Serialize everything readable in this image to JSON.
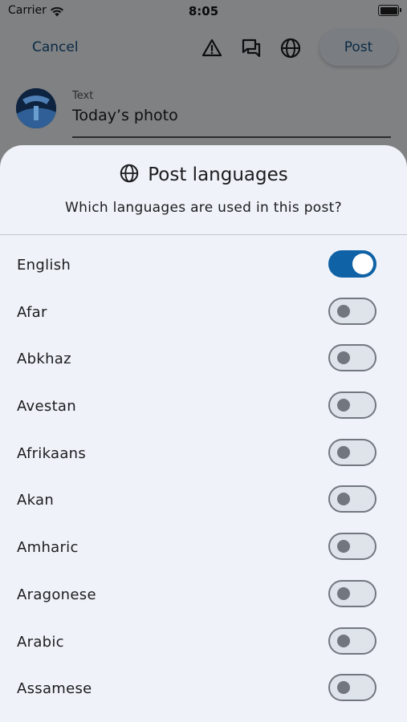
{
  "status_bar": {
    "carrier": "Carrier",
    "time": "8:05"
  },
  "compose": {
    "cancel_label": "Cancel",
    "post_label": "Post",
    "icons": [
      "warning-icon",
      "threadgate-icon",
      "globe-icon"
    ],
    "text_field_label": "Text",
    "text_field_value": "Today’s photo"
  },
  "sheet": {
    "title": "Post languages",
    "subtitle": "Which languages are used in this post?",
    "languages": [
      {
        "label": "English",
        "enabled": true
      },
      {
        "label": "Afar",
        "enabled": false
      },
      {
        "label": "Abkhaz",
        "enabled": false
      },
      {
        "label": "Avestan",
        "enabled": false
      },
      {
        "label": "Afrikaans",
        "enabled": false
      },
      {
        "label": "Akan",
        "enabled": false
      },
      {
        "label": "Amharic",
        "enabled": false
      },
      {
        "label": "Aragonese",
        "enabled": false
      },
      {
        "label": "Arabic",
        "enabled": false
      },
      {
        "label": "Assamese",
        "enabled": false
      }
    ]
  },
  "colors": {
    "accent": "#0f62a6",
    "sheet_bg": "#eff2f8",
    "scrim": "#808284"
  }
}
